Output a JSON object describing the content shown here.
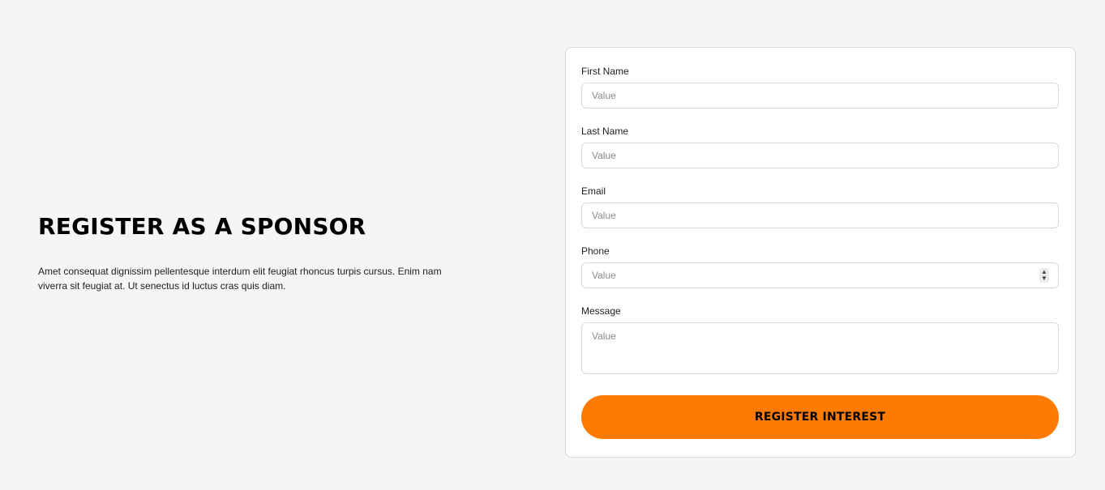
{
  "intro": {
    "heading": "REGISTER AS A SPONSOR",
    "body": "Amet consequat dignissim pellentesque interdum elit feugiat rhoncus turpis cursus. Enim nam viverra sit feugiat at. Ut senectus id luctus cras quis diam."
  },
  "form": {
    "first_name": {
      "label": "First Name",
      "placeholder": "Value"
    },
    "last_name": {
      "label": "Last Name",
      "placeholder": "Value"
    },
    "email": {
      "label": "Email",
      "placeholder": "Value"
    },
    "phone": {
      "label": "Phone",
      "placeholder": "Value"
    },
    "message": {
      "label": "Message",
      "placeholder": "Value"
    },
    "submit_label": "REGISTER INTEREST"
  },
  "icons": {
    "stepper_up": "chevron-up-icon",
    "stepper_down": "chevron-down-icon"
  },
  "colors": {
    "accent": "#ff7a00",
    "background": "#f5f5f5",
    "card": "#ffffff",
    "border": "#d9d9d9"
  }
}
